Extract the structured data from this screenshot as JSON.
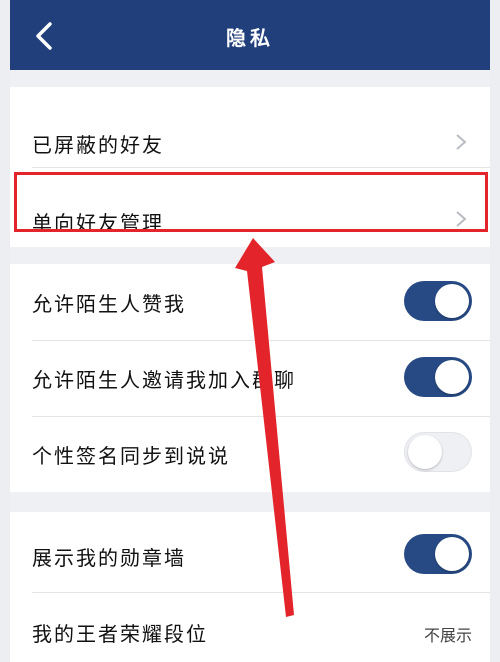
{
  "header": {
    "title": "隐私",
    "background": "#213f7b"
  },
  "sections": [
    {
      "rows": [
        {
          "label": "已屏蔽的好友",
          "type": "link"
        },
        {
          "label": "单向好友管理",
          "type": "link",
          "highlighted": true
        }
      ]
    },
    {
      "rows": [
        {
          "label": "允许陌生人赞我",
          "type": "toggle",
          "on": true
        },
        {
          "label": "允许陌生人邀请我加入群聊",
          "type": "toggle",
          "on": true
        },
        {
          "label": "个性签名同步到说说",
          "type": "toggle",
          "on": false
        }
      ]
    },
    {
      "rows": [
        {
          "label": "展示我的勋章墙",
          "type": "toggle",
          "on": true
        },
        {
          "label": "我的王者荣耀段位",
          "type": "value",
          "value": "不展示"
        }
      ]
    }
  ],
  "annotation": {
    "color": "#e3252b"
  },
  "colors": {
    "toggle_on": "#274a84",
    "toggle_off": "#eef0f3",
    "page_bg": "#eff0f4"
  }
}
